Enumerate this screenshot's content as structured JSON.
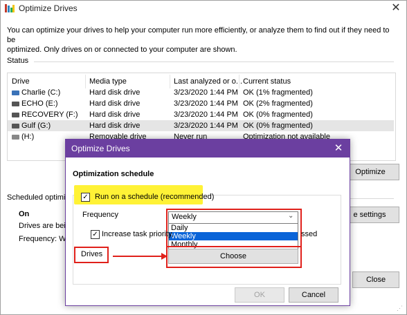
{
  "window": {
    "title": "Optimize Drives",
    "close_glyph": "✕",
    "intro_line1": "You can optimize your drives to help your computer run more efficiently, or analyze them to find out if they need to be",
    "intro_line2": "optimized. Only drives on or connected to your computer are shown.",
    "status_label": "Status"
  },
  "table": {
    "headers": [
      "Drive",
      "Media type",
      "Last analyzed or o...",
      "Current status"
    ],
    "rows": [
      {
        "drive": "Charlie (C:)",
        "media": "Hard disk drive",
        "last": "3/23/2020 1:44 PM",
        "status": "OK (1% fragmented)",
        "icon": "system-drive-icon"
      },
      {
        "drive": "ECHO (E:)",
        "media": "Hard disk drive",
        "last": "3/23/2020 1:44 PM",
        "status": "OK (2% fragmented)",
        "icon": "hard-drive-icon"
      },
      {
        "drive": "RECOVERY (F:)",
        "media": "Hard disk drive",
        "last": "3/23/2020 1:44 PM",
        "status": "OK (0% fragmented)",
        "icon": "hard-drive-icon"
      },
      {
        "drive": "Gulf (G:)",
        "media": "Hard disk drive",
        "last": "3/23/2020 1:44 PM",
        "status": "OK (0% fragmented)",
        "icon": "hard-drive-icon"
      },
      {
        "drive": "(H:)",
        "media": "Removable drive",
        "last": "Never run",
        "status": "Optimization not available",
        "icon": "removable-drive-icon"
      }
    ]
  },
  "main": {
    "optimize_label": "Optimize",
    "scheduled_label": "Scheduled optimiz",
    "on_label": "On",
    "drives_being": "Drives are being",
    "frequency_text": "Frequency: Wee",
    "change_settings_label": "e settings",
    "close_label": "Close"
  },
  "dialog": {
    "title": "Optimize Drives",
    "close_glyph": "✕",
    "section_title": "Optimization schedule",
    "run_on_schedule_label": "Run on a schedule (recommended)",
    "run_on_schedule_checked": true,
    "frequency_label": "Frequency",
    "frequency_value": "Weekly",
    "frequency_options": [
      "Daily",
      "Weekly",
      "Monthly"
    ],
    "frequency_selected_index": 1,
    "increase_priority_label": "Increase task priority,",
    "increase_priority_tail": "ssed",
    "increase_priority_checked": true,
    "drives_label": "Drives",
    "choose_label": "Choose",
    "ok_label": "OK",
    "cancel_label": "Cancel"
  },
  "colors": {
    "dialog_accent": "#6b3fa0",
    "highlight_yellow": "#fff236",
    "annotation_red": "#e0201a",
    "selection_blue": "#0a64d8"
  }
}
